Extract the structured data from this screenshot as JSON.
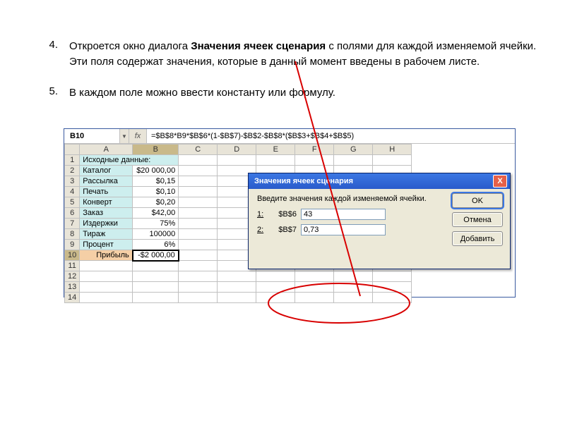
{
  "points": {
    "n4": "4.",
    "p4a": "Откроется окно диалога ",
    "p4b_bold": "Значения ячеек сценария",
    "p4c": "  с полями для каждой изменяемой ячейки. Эти поля содержат значения, которые в данный момент введены в рабочем листе.",
    "n5": "5.",
    "p5": "В каждом поле можно ввести константу или формулу."
  },
  "fx": {
    "cell": "B10",
    "label": "fx",
    "formula": "=$B$8*B9*$B$6*(1-$B$7)-$B$2-$B$8*($B$3+$B$4+$B$5)"
  },
  "cols": [
    "A",
    "B",
    "C",
    "D",
    "E",
    "F",
    "G",
    "H"
  ],
  "rows": [
    {
      "n": "1",
      "a": "Исходные данные:",
      "b": ""
    },
    {
      "n": "2",
      "a": "Каталог",
      "b": "$20 000,00"
    },
    {
      "n": "3",
      "a": "Рассылка",
      "b": "$0,15"
    },
    {
      "n": "4",
      "a": "Печать",
      "b": "$0,10"
    },
    {
      "n": "5",
      "a": "Конверт",
      "b": "$0,20"
    },
    {
      "n": "6",
      "a": "Заказ",
      "b": "$42,00"
    },
    {
      "n": "7",
      "a": "Издержки",
      "b": "75%"
    },
    {
      "n": "8",
      "a": "Тираж",
      "b": "100000"
    },
    {
      "n": "9",
      "a": "Процент",
      "b": "6%"
    },
    {
      "n": "10",
      "a": "Прибыль",
      "b": "-$2 000,00"
    },
    {
      "n": "11",
      "a": "",
      "b": ""
    },
    {
      "n": "12",
      "a": "",
      "b": ""
    },
    {
      "n": "13",
      "a": "",
      "b": ""
    },
    {
      "n": "14",
      "a": "",
      "b": ""
    }
  ],
  "dialog": {
    "title": "Значения ячеек сценария",
    "prompt": "Введите значения каждой изменяемой ячейки.",
    "row1_idx": "1:",
    "row1_ref": "$B$6",
    "row1_val": "43",
    "row2_idx": "2:",
    "row2_ref": "$B$7",
    "row2_val": "0,73",
    "btn_ok": "OK",
    "btn_cancel": "Отмена",
    "btn_add": "Добавить",
    "close": "X"
  }
}
